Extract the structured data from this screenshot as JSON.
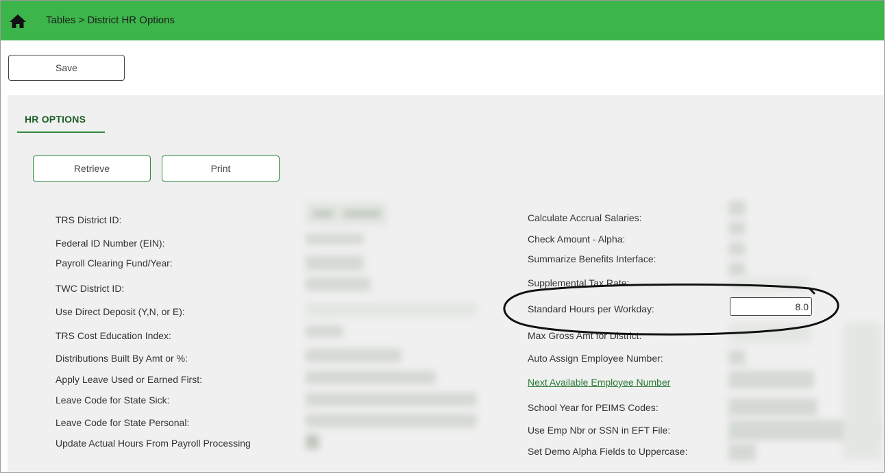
{
  "header": {
    "home_icon": "home-icon",
    "breadcrumb": "Tables > District HR Options"
  },
  "toolbar": {
    "save_label": "Save"
  },
  "tab": {
    "label": "HR OPTIONS"
  },
  "actions": {
    "retrieve_label": "Retrieve",
    "print_label": "Print"
  },
  "left_fields": [
    {
      "label": "TRS District ID:"
    },
    {
      "label": "Federal ID Number (EIN):"
    },
    {
      "label": "Payroll Clearing Fund/Year:"
    },
    {
      "label": "TWC District ID:"
    },
    {
      "label": "Use Direct Deposit (Y,N, or E):"
    },
    {
      "label": "TRS Cost Education Index:"
    },
    {
      "label": "Distributions Built By Amt or %:"
    },
    {
      "label": "Apply Leave Used or Earned First:"
    },
    {
      "label": "Leave Code for State Sick:"
    },
    {
      "label": "Leave Code for State Personal:"
    },
    {
      "label": "Update Actual Hours From Payroll Processing"
    }
  ],
  "right_fields": [
    {
      "label": "Calculate Accrual Salaries:"
    },
    {
      "label": "Check Amount - Alpha:"
    },
    {
      "label": "Summarize Benefits Interface:"
    },
    {
      "label": "Supplemental Tax Rate:"
    },
    {
      "label": "Standard Hours per Workday:",
      "value": "8.0"
    },
    {
      "label": "Max Gross Amt for District:"
    },
    {
      "label": "Auto Assign Employee Number:"
    },
    {
      "label": "Next Available Employee Number"
    },
    {
      "label": "School Year for PEIMS Codes:"
    },
    {
      "label": "Use Emp Nbr or SSN in EFT File:"
    },
    {
      "label": "Set Demo Alpha Fields to Uppercase:"
    }
  ],
  "colors": {
    "header_green": "#3cb54a",
    "accent_green": "#2f8a3c",
    "panel_gray": "#f0f0f0"
  }
}
